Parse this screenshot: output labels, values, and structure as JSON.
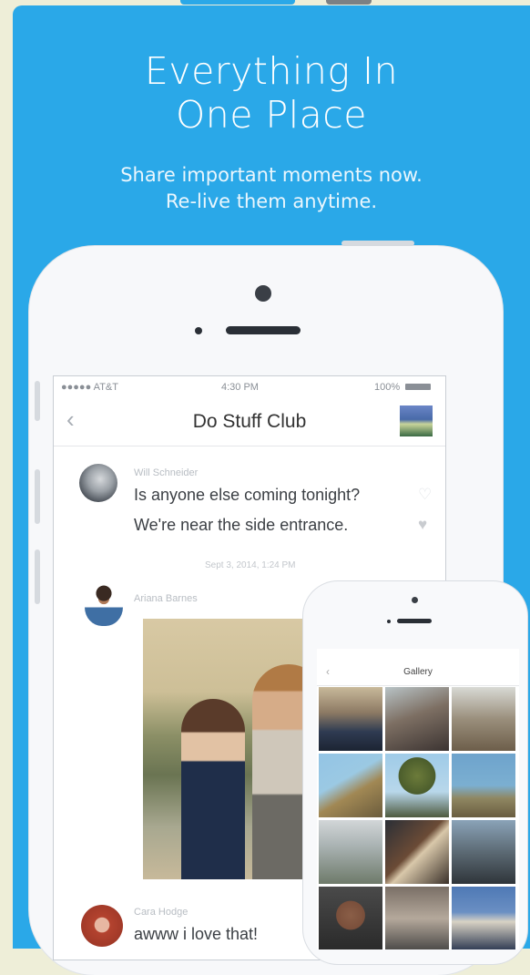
{
  "promo": {
    "headline_line1": "Everything In",
    "headline_line2": "One Place",
    "sub_line1": "Share important moments now.",
    "sub_line2": "Re-live them anytime."
  },
  "status_bar": {
    "carrier": "●●●●● AT&T",
    "time": "4:30 PM",
    "battery": "100%"
  },
  "chat": {
    "title": "Do Stuff Club",
    "back_icon": "chevron-left-icon",
    "messages": [
      {
        "sender": "Will Schneider",
        "lines": [
          "Is anyone else coming tonight?",
          "We're near the side entrance."
        ]
      },
      {
        "sender": "Ariana Barnes"
      },
      {
        "sender": "Cara Hodge",
        "lines": [
          "awww i love that!"
        ]
      }
    ],
    "timestamp": "Sept 3, 2014, 1:24 PM"
  },
  "gallery": {
    "title": "Gallery"
  },
  "colors": {
    "background": "#2aa8e8",
    "outer": "#eeeed8"
  }
}
